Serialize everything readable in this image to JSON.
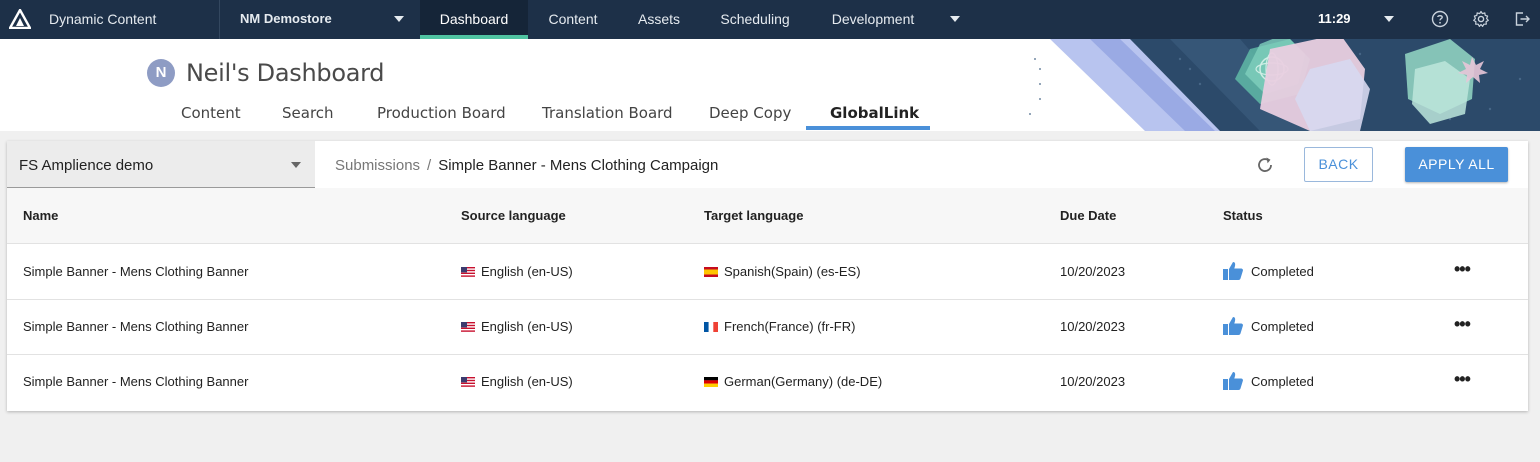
{
  "topbar": {
    "app_title": "Dynamic Content",
    "store": "NM Demostore",
    "tabs": [
      "Dashboard",
      "Content",
      "Assets",
      "Scheduling",
      "Development"
    ],
    "active_tab": "Dashboard",
    "time": "11:29"
  },
  "header": {
    "avatar_initial": "N",
    "title": "Neil's Dashboard",
    "tabs": [
      "Content",
      "Search",
      "Production Board",
      "Translation Board",
      "Deep Copy",
      "GlobalLink"
    ],
    "active_tab": "GlobalLink"
  },
  "toolbar": {
    "project": "FS Amplience demo",
    "breadcrumb_root": "Submissions",
    "breadcrumb_sep": "/",
    "breadcrumb_current": "Simple Banner - Mens Clothing Campaign",
    "back_label": "BACK",
    "apply_label": "APPLY ALL"
  },
  "table": {
    "columns": [
      "Name",
      "Source language",
      "Target language",
      "Due Date",
      "Status"
    ],
    "rows": [
      {
        "name": "Simple Banner - Mens Clothing Banner",
        "source": "English (en-US)",
        "source_flag": "us-flag",
        "target": "Spanish(Spain) (es-ES)",
        "target_flag": "es-flag",
        "due": "10/20/2023",
        "status": "Completed"
      },
      {
        "name": "Simple Banner - Mens Clothing Banner",
        "source": "English (en-US)",
        "source_flag": "us-flag",
        "target": "French(France) (fr-FR)",
        "target_flag": "fr-flag",
        "due": "10/20/2023",
        "status": "Completed"
      },
      {
        "name": "Simple Banner - Mens Clothing Banner",
        "source": "English (en-US)",
        "source_flag": "us-flag",
        "target": "German(Germany) (de-DE)",
        "target_flag": "de-flag",
        "due": "10/20/2023",
        "status": "Completed"
      }
    ]
  },
  "colors": {
    "topbar": "#1d3048",
    "active_tab_indicator": "#4fc3a1",
    "accent": "#4a90d9"
  }
}
